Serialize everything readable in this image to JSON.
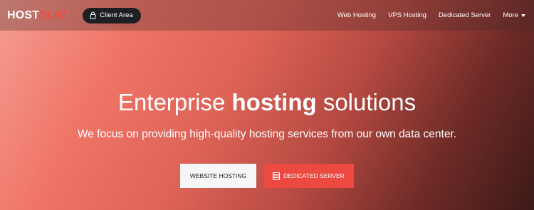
{
  "brand": {
    "part1": "HOST",
    "part2": "SLIM",
    "accent_color": "#ef4a3f"
  },
  "navbar": {
    "client_area_label": "Client Area",
    "client_area_icon": "lock-icon",
    "links": [
      {
        "label": "Web Hosting"
      },
      {
        "label": "VPS Hosting"
      },
      {
        "label": "Dedicated Server"
      },
      {
        "label": "More"
      }
    ]
  },
  "hero": {
    "headline_regular": "Enterprise",
    "headline_bold": "hosting",
    "headline_tail": "solutions",
    "subline": "We focus on providing high-quality hosting services from our own data center.",
    "buttons": {
      "website_hosting": "WEBSITE HOSTING",
      "dedicated_server": "DEDICATED SERVER",
      "dedicated_server_icon": "server-icon",
      "dedicated_color": "#ec4a40"
    }
  }
}
